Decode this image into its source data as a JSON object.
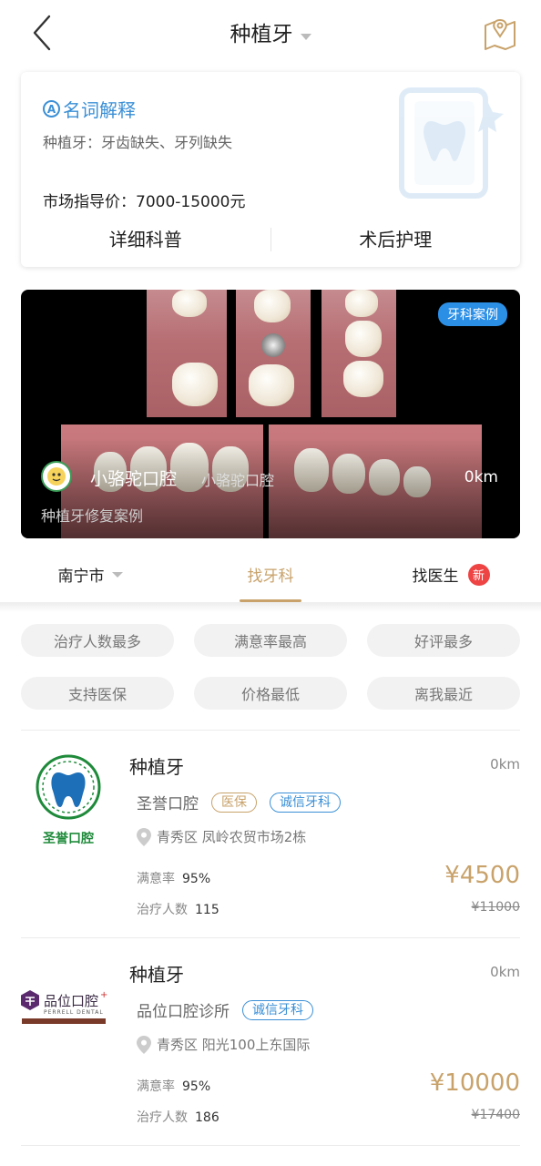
{
  "header": {
    "title": "种植牙"
  },
  "info_card": {
    "term_icon_letter": "A",
    "term_title": "名词解释",
    "term_desc": "种植牙：牙齿缺失、牙列缺失",
    "market_price": "市场指导价：7000-15000元",
    "tabs": [
      "详细科普",
      "术后护理"
    ]
  },
  "banner": {
    "badge": "牙科案例",
    "clinic_name": "小骆驼口腔",
    "clinic_sub": "小骆驼口腔",
    "distance": "0km",
    "case_title": "种植牙修复案例"
  },
  "nav": {
    "city": "南宁市",
    "find_clinic": "找牙科",
    "find_doctor": "找医生",
    "new_badge": "新"
  },
  "filters": [
    "治疗人数最多",
    "满意率最高",
    "好评最多",
    "支持医保",
    "价格最低",
    "离我最近"
  ],
  "listings": [
    {
      "name": "种植牙",
      "distance": "0km",
      "clinic": "圣誉口腔",
      "tags": [
        "医保",
        "诚信牙科"
      ],
      "address": "青秀区 凤岭农贸市场2栋",
      "satisfaction_label": "满意率",
      "satisfaction": "95%",
      "patients_label": "治疗人数",
      "patients": "115",
      "price": "¥4500",
      "original_price": "¥11000",
      "logo_text": "圣誉口腔"
    },
    {
      "name": "种植牙",
      "distance": "0km",
      "clinic": "品位口腔诊所",
      "tags": [
        "诚信牙科"
      ],
      "address": "青秀区 阳光100上东国际",
      "satisfaction_label": "满意率",
      "satisfaction": "95%",
      "patients_label": "治疗人数",
      "patients": "186",
      "price": "¥10000",
      "original_price": "¥17400",
      "logo_text": "品位口腔",
      "logo_sub": "PERRELL DENTAL"
    }
  ],
  "colors": {
    "accent_gold": "#c8a26a",
    "accent_blue": "#3a8fd6",
    "badge_red": "#ee4444"
  }
}
